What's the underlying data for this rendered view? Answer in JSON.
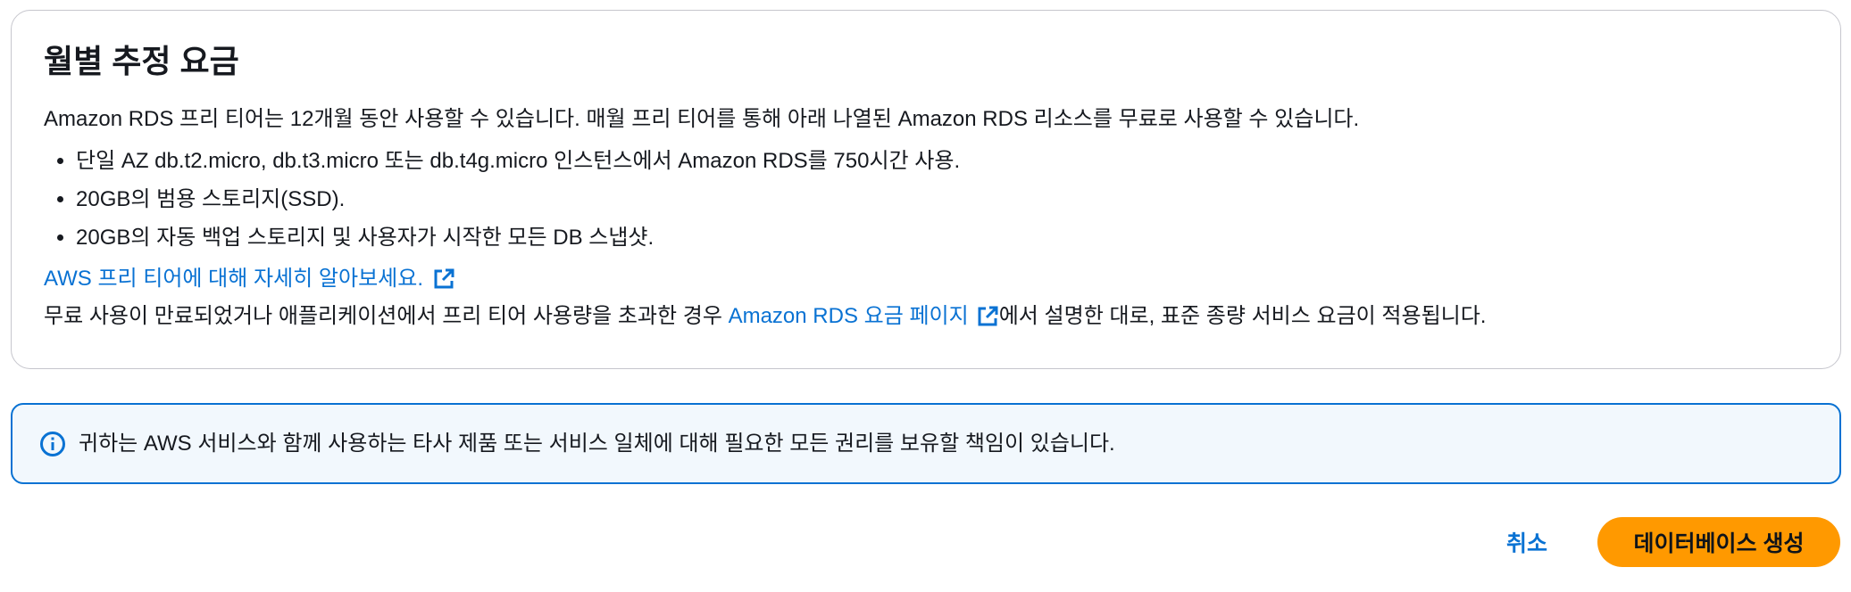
{
  "cost_section": {
    "title": "월별 추정 요금",
    "intro": "Amazon RDS 프리 티어는 12개월 동안 사용할 수 있습니다. 매월 프리 티어를 통해 아래 나열된 Amazon RDS 리소스를 무료로 사용할 수 있습니다.",
    "bullets": [
      "단일 AZ db.t2.micro, db.t3.micro 또는 db.t4g.micro 인스턴스에서 Amazon RDS를 750시간 사용.",
      "20GB의 범용 스토리지(SSD).",
      "20GB의 자동 백업 스토리지 및 사용자가 시작한 모든 DB 스냅샷."
    ],
    "learn_more_link": "AWS 프리 티어에 대해 자세히 알아보세요.",
    "closing_before": "무료 사용이 만료되었거나 애플리케이션에서 프리 티어 사용량을 초과한 경우 ",
    "closing_link": "Amazon RDS 요금 페이지",
    "closing_after": "에서 설명한 대로, 표준 종량 서비스 요금이 적용됩니다.",
    "external_icon": "external-link-icon"
  },
  "info_alert": {
    "icon": "info-icon",
    "text": "귀하는 AWS 서비스와 함께 사용하는 타사 제품 또는 서비스 일체에 대해 필요한 모든 권리를 보유할 책임이 있습니다."
  },
  "actions": {
    "cancel_label": "취소",
    "create_label": "데이터베이스 생성"
  },
  "colors": {
    "link": "#0972d3",
    "primary_button": "#ff9900",
    "alert_background": "#f2f8fd",
    "alert_border": "#0972d3",
    "card_border": "#c6c6cd"
  }
}
